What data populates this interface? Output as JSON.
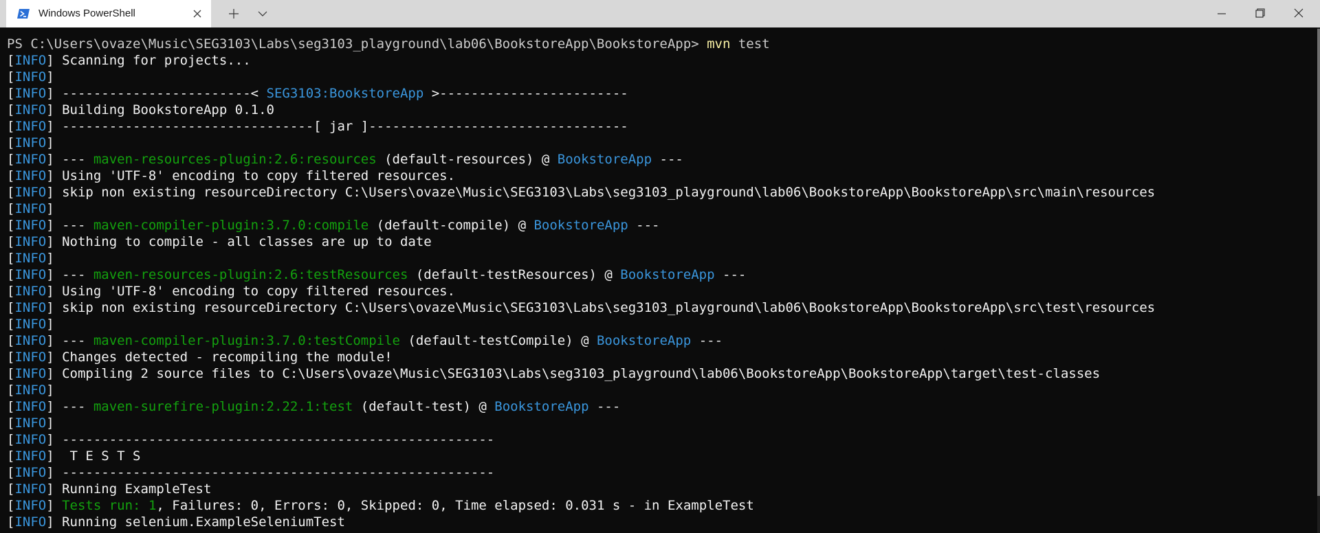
{
  "window": {
    "tab_title": "Windows PowerShell",
    "icons": {
      "tab": "powershell-icon",
      "close": "close-icon",
      "new_tab": "plus-icon",
      "dropdown": "chevron-down-icon",
      "minimize": "minimize-icon",
      "maximize": "restore-icon",
      "close_window": "close-icon"
    }
  },
  "colors": {
    "background": "#0c0c0c",
    "text": "#cccccc",
    "bright": "#f2f2f2",
    "blue": "#3a96dd",
    "green": "#13a10e",
    "yellow": "#f9f1a5",
    "titlebar": "#d8d8d8"
  },
  "terminal": {
    "lines": [
      {
        "segments": [
          {
            "c": "l",
            "t": "PS C:\\Users\\ovaze\\Music\\SEG3103\\Labs\\seg3103_playground\\lab06\\BookstoreApp\\BookstoreApp> "
          },
          {
            "c": "y",
            "t": "mvn"
          },
          {
            "c": "l",
            "t": " test"
          }
        ]
      },
      {
        "segments": [
          {
            "c": "w",
            "t": "["
          },
          {
            "c": "b",
            "t": "INFO"
          },
          {
            "c": "w",
            "t": "] Scanning for projects..."
          }
        ]
      },
      {
        "segments": [
          {
            "c": "w",
            "t": "["
          },
          {
            "c": "b",
            "t": "INFO"
          },
          {
            "c": "w",
            "t": "]"
          }
        ]
      },
      {
        "segments": [
          {
            "c": "w",
            "t": "["
          },
          {
            "c": "b",
            "t": "INFO"
          },
          {
            "c": "w",
            "t": "] ------------------------< "
          },
          {
            "c": "b",
            "t": "SEG3103:BookstoreApp"
          },
          {
            "c": "w",
            "t": " >------------------------"
          }
        ]
      },
      {
        "segments": [
          {
            "c": "w",
            "t": "["
          },
          {
            "c": "b",
            "t": "INFO"
          },
          {
            "c": "w",
            "t": "] Building BookstoreApp 0.1.0"
          }
        ]
      },
      {
        "segments": [
          {
            "c": "w",
            "t": "["
          },
          {
            "c": "b",
            "t": "INFO"
          },
          {
            "c": "w",
            "t": "] --------------------------------[ jar ]---------------------------------"
          }
        ]
      },
      {
        "segments": [
          {
            "c": "w",
            "t": "["
          },
          {
            "c": "b",
            "t": "INFO"
          },
          {
            "c": "w",
            "t": "]"
          }
        ]
      },
      {
        "segments": [
          {
            "c": "w",
            "t": "["
          },
          {
            "c": "b",
            "t": "INFO"
          },
          {
            "c": "w",
            "t": "] --- "
          },
          {
            "c": "g",
            "t": "maven-resources-plugin:2.6:resources"
          },
          {
            "c": "w",
            "t": " (default-resources) @ "
          },
          {
            "c": "b",
            "t": "BookstoreApp"
          },
          {
            "c": "w",
            "t": " ---"
          }
        ]
      },
      {
        "segments": [
          {
            "c": "w",
            "t": "["
          },
          {
            "c": "b",
            "t": "INFO"
          },
          {
            "c": "w",
            "t": "] Using 'UTF-8' encoding to copy filtered resources."
          }
        ]
      },
      {
        "segments": [
          {
            "c": "w",
            "t": "["
          },
          {
            "c": "b",
            "t": "INFO"
          },
          {
            "c": "w",
            "t": "] skip non existing resourceDirectory C:\\Users\\ovaze\\Music\\SEG3103\\Labs\\seg3103_playground\\lab06\\BookstoreApp\\BookstoreApp\\src\\main\\resources"
          }
        ]
      },
      {
        "segments": [
          {
            "c": "w",
            "t": "["
          },
          {
            "c": "b",
            "t": "INFO"
          },
          {
            "c": "w",
            "t": "]"
          }
        ]
      },
      {
        "segments": [
          {
            "c": "w",
            "t": "["
          },
          {
            "c": "b",
            "t": "INFO"
          },
          {
            "c": "w",
            "t": "] --- "
          },
          {
            "c": "g",
            "t": "maven-compiler-plugin:3.7.0:compile"
          },
          {
            "c": "w",
            "t": " (default-compile) @ "
          },
          {
            "c": "b",
            "t": "BookstoreApp"
          },
          {
            "c": "w",
            "t": " ---"
          }
        ]
      },
      {
        "segments": [
          {
            "c": "w",
            "t": "["
          },
          {
            "c": "b",
            "t": "INFO"
          },
          {
            "c": "w",
            "t": "] Nothing to compile - all classes are up to date"
          }
        ]
      },
      {
        "segments": [
          {
            "c": "w",
            "t": "["
          },
          {
            "c": "b",
            "t": "INFO"
          },
          {
            "c": "w",
            "t": "]"
          }
        ]
      },
      {
        "segments": [
          {
            "c": "w",
            "t": "["
          },
          {
            "c": "b",
            "t": "INFO"
          },
          {
            "c": "w",
            "t": "] --- "
          },
          {
            "c": "g",
            "t": "maven-resources-plugin:2.6:testResources"
          },
          {
            "c": "w",
            "t": " (default-testResources) @ "
          },
          {
            "c": "b",
            "t": "BookstoreApp"
          },
          {
            "c": "w",
            "t": " ---"
          }
        ]
      },
      {
        "segments": [
          {
            "c": "w",
            "t": "["
          },
          {
            "c": "b",
            "t": "INFO"
          },
          {
            "c": "w",
            "t": "] Using 'UTF-8' encoding to copy filtered resources."
          }
        ]
      },
      {
        "segments": [
          {
            "c": "w",
            "t": "["
          },
          {
            "c": "b",
            "t": "INFO"
          },
          {
            "c": "w",
            "t": "] skip non existing resourceDirectory C:\\Users\\ovaze\\Music\\SEG3103\\Labs\\seg3103_playground\\lab06\\BookstoreApp\\BookstoreApp\\src\\test\\resources"
          }
        ]
      },
      {
        "segments": [
          {
            "c": "w",
            "t": "["
          },
          {
            "c": "b",
            "t": "INFO"
          },
          {
            "c": "w",
            "t": "]"
          }
        ]
      },
      {
        "segments": [
          {
            "c": "w",
            "t": "["
          },
          {
            "c": "b",
            "t": "INFO"
          },
          {
            "c": "w",
            "t": "] --- "
          },
          {
            "c": "g",
            "t": "maven-compiler-plugin:3.7.0:testCompile"
          },
          {
            "c": "w",
            "t": " (default-testCompile) @ "
          },
          {
            "c": "b",
            "t": "BookstoreApp"
          },
          {
            "c": "w",
            "t": " ---"
          }
        ]
      },
      {
        "segments": [
          {
            "c": "w",
            "t": "["
          },
          {
            "c": "b",
            "t": "INFO"
          },
          {
            "c": "w",
            "t": "] Changes detected - recompiling the module!"
          }
        ]
      },
      {
        "segments": [
          {
            "c": "w",
            "t": "["
          },
          {
            "c": "b",
            "t": "INFO"
          },
          {
            "c": "w",
            "t": "] Compiling 2 source files to C:\\Users\\ovaze\\Music\\SEG3103\\Labs\\seg3103_playground\\lab06\\BookstoreApp\\BookstoreApp\\target\\test-classes"
          }
        ]
      },
      {
        "segments": [
          {
            "c": "w",
            "t": "["
          },
          {
            "c": "b",
            "t": "INFO"
          },
          {
            "c": "w",
            "t": "]"
          }
        ]
      },
      {
        "segments": [
          {
            "c": "w",
            "t": "["
          },
          {
            "c": "b",
            "t": "INFO"
          },
          {
            "c": "w",
            "t": "] --- "
          },
          {
            "c": "g",
            "t": "maven-surefire-plugin:2.22.1:test"
          },
          {
            "c": "w",
            "t": " (default-test) @ "
          },
          {
            "c": "b",
            "t": "BookstoreApp"
          },
          {
            "c": "w",
            "t": " ---"
          }
        ]
      },
      {
        "segments": [
          {
            "c": "w",
            "t": "["
          },
          {
            "c": "b",
            "t": "INFO"
          },
          {
            "c": "w",
            "t": "]"
          }
        ]
      },
      {
        "segments": [
          {
            "c": "w",
            "t": "["
          },
          {
            "c": "b",
            "t": "INFO"
          },
          {
            "c": "w",
            "t": "] -------------------------------------------------------"
          }
        ]
      },
      {
        "segments": [
          {
            "c": "w",
            "t": "["
          },
          {
            "c": "b",
            "t": "INFO"
          },
          {
            "c": "w",
            "t": "]  T E S T S"
          }
        ]
      },
      {
        "segments": [
          {
            "c": "w",
            "t": "["
          },
          {
            "c": "b",
            "t": "INFO"
          },
          {
            "c": "w",
            "t": "] -------------------------------------------------------"
          }
        ]
      },
      {
        "segments": [
          {
            "c": "w",
            "t": "["
          },
          {
            "c": "b",
            "t": "INFO"
          },
          {
            "c": "w",
            "t": "] Running "
          },
          {
            "c": "w",
            "t": "ExampleTest"
          }
        ]
      },
      {
        "segments": [
          {
            "c": "w",
            "t": "["
          },
          {
            "c": "b",
            "t": "INFO"
          },
          {
            "c": "w",
            "t": "] "
          },
          {
            "c": "g",
            "t": "Tests run: 1"
          },
          {
            "c": "w",
            "t": ", Failures: 0, Errors: 0, Skipped: 0, Time elapsed: 0.031 s - in "
          },
          {
            "c": "w",
            "t": "ExampleTest"
          }
        ]
      },
      {
        "segments": [
          {
            "c": "w",
            "t": "["
          },
          {
            "c": "b",
            "t": "INFO"
          },
          {
            "c": "w",
            "t": "] Running selenium."
          },
          {
            "c": "w",
            "t": "ExampleSeleniumTest"
          }
        ]
      }
    ]
  }
}
